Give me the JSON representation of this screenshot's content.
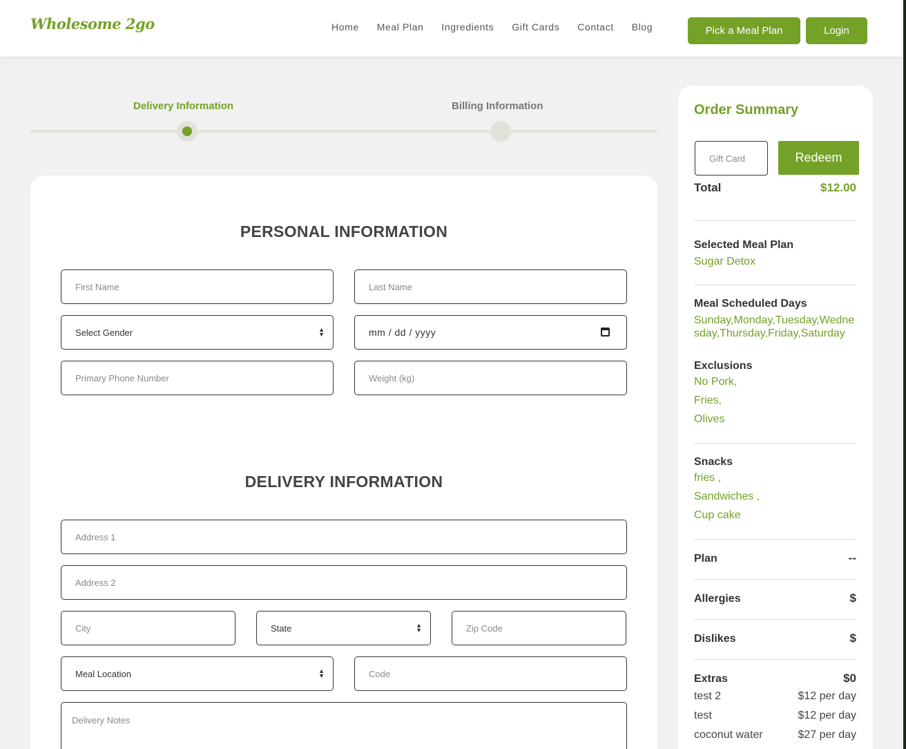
{
  "header": {
    "logo": "Wholesome 2go",
    "nav": [
      "Home",
      "Meal Plan",
      "Ingredients",
      "Gift Cards",
      "Contact",
      "Blog"
    ],
    "pick_button": "Pick a Meal Plan",
    "login_button": "Login"
  },
  "steps": {
    "step1": "Delivery Information",
    "step2": "Billing Information",
    "active": 1
  },
  "personal": {
    "title": "PERSONAL INFORMATION",
    "first_name_placeholder": "First Name",
    "last_name_placeholder": "Last Name",
    "gender_selected": "Select Gender",
    "date_placeholder": "mm / dd / yyyy",
    "phone_placeholder": "Primary Phone Number",
    "weight_placeholder": "Weight (kg)"
  },
  "delivery": {
    "title": "DELIVERY INFORMATION",
    "address1_placeholder": "Address 1",
    "address2_placeholder": "Address 2",
    "city_placeholder": "City",
    "state_selected": "State",
    "zip_placeholder": "Zip Code",
    "meal_location_selected": "Meal Location",
    "code_placeholder": "Code",
    "notes_placeholder": "Delivery Notes"
  },
  "summary": {
    "title": "Order Summary",
    "gift_placeholder": "Gift Card",
    "redeem": "Redeem",
    "total_label": "Total",
    "total_value": "$12.00",
    "selected_plan_label": "Selected Meal Plan",
    "selected_plan_value": "Sugar Detox",
    "scheduled_label": "Meal Scheduled Days",
    "scheduled_value": "Sunday,Monday,Tuesday,Wednesday,Thursday,Friday,Saturday",
    "exclusions_label": "Exclusions",
    "exclusions": [
      "No Pork,",
      "Fries,",
      "Olives"
    ],
    "snacks_label": "Snacks",
    "snacks": [
      "fries ,",
      "Sandwiches ,",
      "Cup cake"
    ],
    "plan_label": "Plan",
    "plan_value": "--",
    "allergies_label": "Allergies",
    "allergies_value": "$",
    "dislikes_label": "Dislikes",
    "dislikes_value": "$",
    "extras_label": "Extras",
    "extras_value": "$0",
    "extras": [
      {
        "name": "test 2",
        "price": "$12 per day"
      },
      {
        "name": "test",
        "price": "$12 per day"
      },
      {
        "name": "coconut water",
        "price": "$27 per day"
      }
    ]
  },
  "colors": {
    "accent": "#74a127",
    "background": "#f1f1f1"
  }
}
